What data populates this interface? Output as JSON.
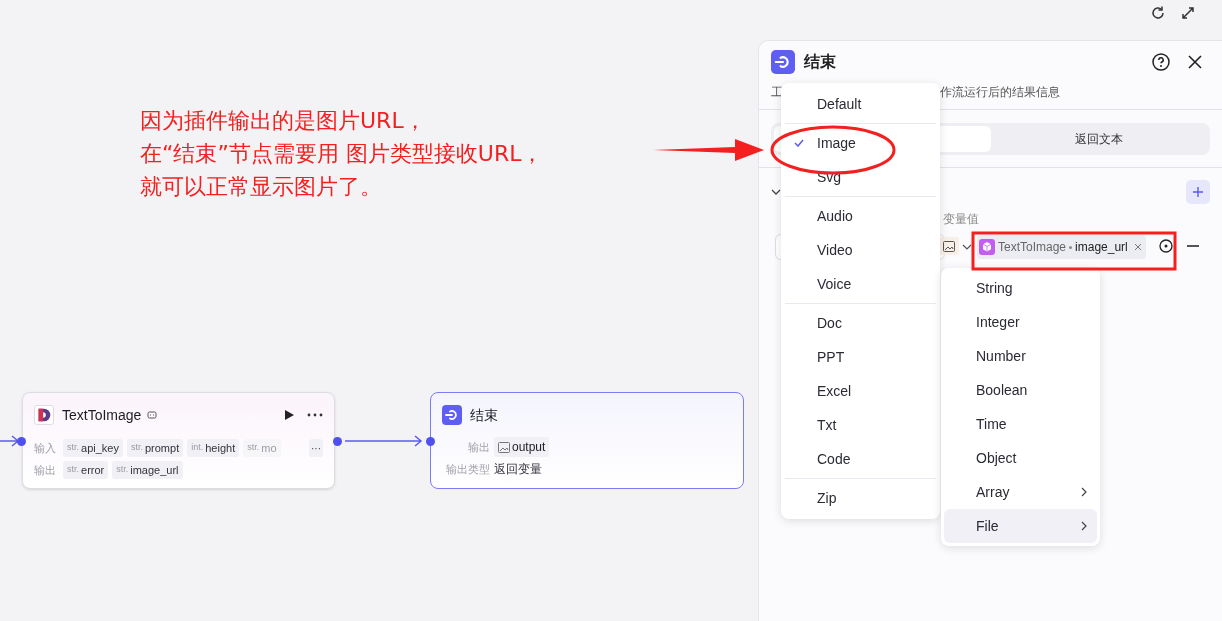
{
  "annotation": {
    "lines": [
      "因为插件输出的是图片URL，",
      "在“结束”节点需要用 图片类型接收URL，",
      "就可以正常显示图片了。"
    ]
  },
  "canvas": {
    "plugin_node": {
      "title": "TextToImage",
      "input_label": "输入",
      "inputs": [
        {
          "type": "str.",
          "name": "api_key",
          "faded": false
        },
        {
          "type": "str.",
          "name": "prompt",
          "faded": false
        },
        {
          "type": "int.",
          "name": "height",
          "faded": false
        },
        {
          "type": "str.",
          "name": "mo",
          "faded": true
        }
      ],
      "more": "···",
      "output_label": "输出",
      "outputs": [
        {
          "type": "str.",
          "name": "error"
        },
        {
          "type": "str.",
          "name": "image_url"
        }
      ]
    },
    "end_node": {
      "title": "结束",
      "output_label": "输出",
      "output_name": "output",
      "output_type_label": "输出类型",
      "output_type": "返回变量"
    }
  },
  "panel": {
    "title": "结束",
    "description_start": "工",
    "description_end": "作流运行后的结果信息",
    "segments": [
      {
        "selected": true
      },
      {
        "label": "返回文本",
        "selected": false
      }
    ],
    "value_label": "变量值",
    "reference": {
      "node": "TextToImage",
      "field": "image_url"
    }
  },
  "type_menu": [
    {
      "kind": "item",
      "label": "Default",
      "checked": false
    },
    {
      "kind": "separator"
    },
    {
      "kind": "item",
      "label": "Image",
      "checked": true
    },
    {
      "kind": "item",
      "label": "Svg",
      "checked": false
    },
    {
      "kind": "separator"
    },
    {
      "kind": "item",
      "label": "Audio",
      "checked": false
    },
    {
      "kind": "item",
      "label": "Video",
      "checked": false
    },
    {
      "kind": "item",
      "label": "Voice",
      "checked": false
    },
    {
      "kind": "separator"
    },
    {
      "kind": "item",
      "label": "Doc",
      "checked": false
    },
    {
      "kind": "item",
      "label": "PPT",
      "checked": false
    },
    {
      "kind": "item",
      "label": "Excel",
      "checked": false
    },
    {
      "kind": "item",
      "label": "Txt",
      "checked": false
    },
    {
      "kind": "item",
      "label": "Code",
      "checked": false
    },
    {
      "kind": "separator"
    },
    {
      "kind": "item",
      "label": "Zip",
      "checked": false
    }
  ],
  "type_submenu": [
    {
      "label": "String",
      "has_submenu": false,
      "selected": false
    },
    {
      "label": "Integer",
      "has_submenu": false,
      "selected": false
    },
    {
      "label": "Number",
      "has_submenu": false,
      "selected": false
    },
    {
      "label": "Boolean",
      "has_submenu": false,
      "selected": false
    },
    {
      "label": "Time",
      "has_submenu": false,
      "selected": false
    },
    {
      "label": "Object",
      "has_submenu": false,
      "selected": false
    },
    {
      "label": "Array",
      "has_submenu": true,
      "selected": false
    },
    {
      "label": "File",
      "has_submenu": true,
      "selected": true
    }
  ]
}
